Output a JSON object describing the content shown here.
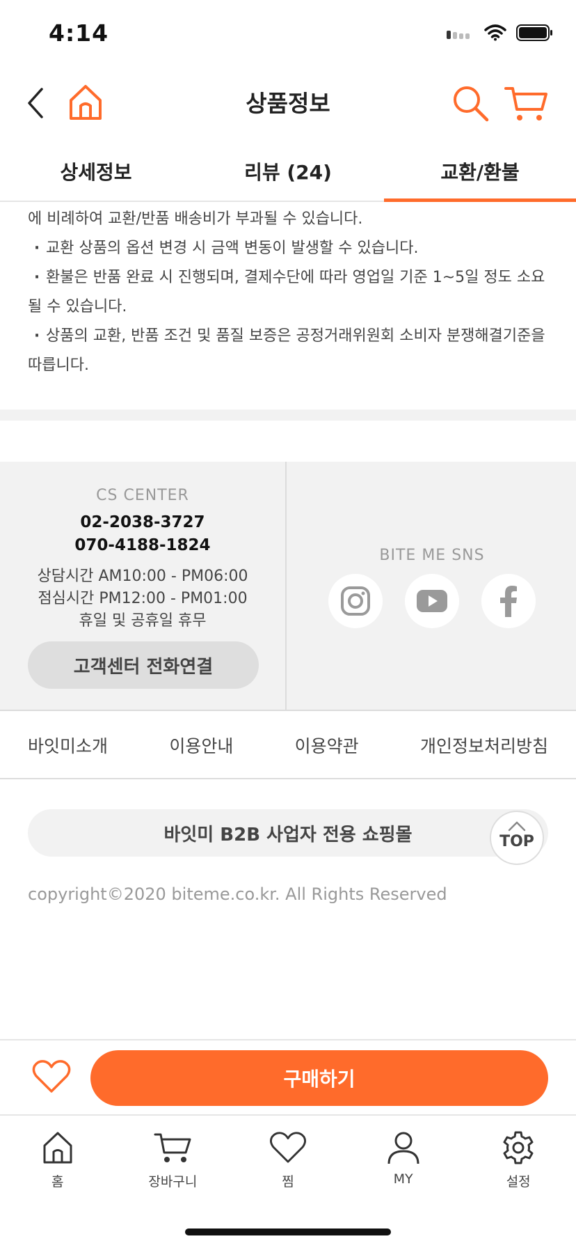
{
  "status_bar": {
    "time": "4:14"
  },
  "nav": {
    "title": "상품정보"
  },
  "tabs": [
    {
      "label": "상세정보"
    },
    {
      "label": "리뷰 (24)"
    },
    {
      "label": "교환/환불"
    }
  ],
  "policy": {
    "lines": [
      "에 비례하여 교환/반품 배송비가 부과될 수 있습니다.",
      "교환 상품의 옵션 변경 시 금액 변동이 발생할 수 있습니다.",
      "환불은 반품 완료 시 진행되며, 결제수단에 따라 영업일 기준 1~5일 정도 소요될 수 있습니다.",
      "상품의 교환, 반품 조건 및 품질 보증은 공정거래위원회 소비자 분쟁해결기준을 따릅니다."
    ]
  },
  "cs_center": {
    "title": "CS CENTER",
    "phone1": "02-2038-3727",
    "phone2": "070-4188-1824",
    "hours1": "상담시간 AM10:00 - PM06:00",
    "hours2": "점심시간 PM12:00 - PM01:00",
    "hours3": "휴일 및 공휴일 휴무",
    "call_button": "고객센터 전화연결"
  },
  "sns": {
    "title": "BITE ME SNS",
    "icons": [
      "instagram-icon",
      "youtube-icon",
      "facebook-icon"
    ]
  },
  "footer_links": [
    "바잇미소개",
    "이용안내",
    "이용약관",
    "개인정보처리방침"
  ],
  "b2b": {
    "label": "바잇미 B2B 사업자 전용 쇼핑몰"
  },
  "top_button": {
    "label": "TOP"
  },
  "copyright": "copyright©2020 biteme.co.kr. All Rights Reserved",
  "action": {
    "buy_label": "구매하기"
  },
  "tabbar": [
    {
      "label": "홈",
      "icon": "home-icon"
    },
    {
      "label": "장바구니",
      "icon": "cart-icon"
    },
    {
      "label": "찜",
      "icon": "heart-icon"
    },
    {
      "label": "MY",
      "icon": "user-icon"
    },
    {
      "label": "설정",
      "icon": "gear-icon"
    }
  ],
  "colors": {
    "accent": "#ff6b2b",
    "panel": "#f2f2f2"
  }
}
